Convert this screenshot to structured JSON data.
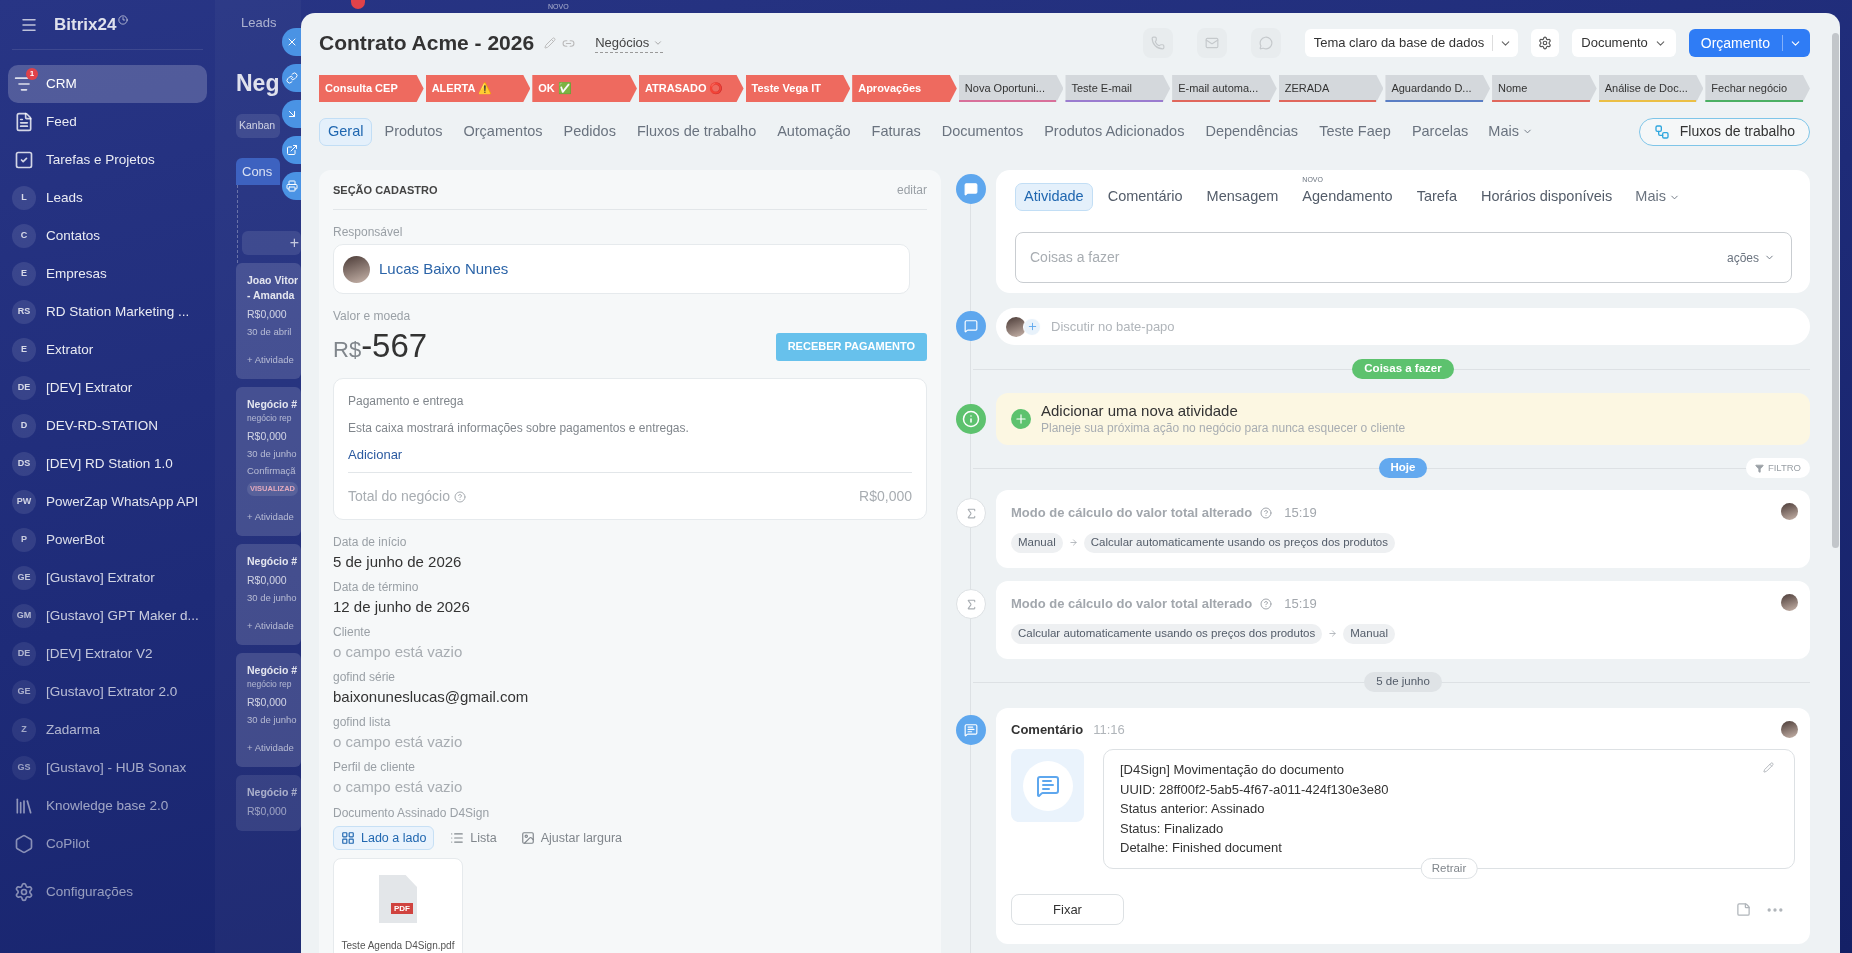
{
  "sidebar": {
    "logo": "Bitrix24",
    "items": [
      {
        "kind": "funnel",
        "label": "CRM",
        "selected": true,
        "counter": "1"
      },
      {
        "kind": "feed",
        "label": "Feed",
        "selected": false
      },
      {
        "kind": "tasks",
        "label": "Tarefas e Projetos",
        "selected": false
      },
      {
        "kind": "initials",
        "initials": "L",
        "label": "Leads",
        "selected": false
      },
      {
        "kind": "initials",
        "initials": "C",
        "label": "Contatos",
        "selected": false
      },
      {
        "kind": "initials",
        "initials": "E",
        "label": "Empresas",
        "selected": false
      },
      {
        "kind": "initials",
        "initials": "RS",
        "label": "RD Station Marketing ...",
        "selected": false
      },
      {
        "kind": "initials",
        "initials": "E",
        "label": "Extrator",
        "selected": false
      },
      {
        "kind": "initials",
        "initials": "DE",
        "label": "[DEV] Extrator",
        "selected": false
      },
      {
        "kind": "initials",
        "initials": "D",
        "label": "DEV-RD-STATION",
        "selected": false
      },
      {
        "kind": "initials",
        "initials": "DS",
        "label": "[DEV] RD Station 1.0",
        "selected": false
      },
      {
        "kind": "initials",
        "initials": "PW",
        "label": "PowerZap WhatsApp API",
        "selected": false
      },
      {
        "kind": "initials",
        "initials": "P",
        "label": "PowerBot",
        "selected": false
      },
      {
        "kind": "initials",
        "initials": "GE",
        "label": "[Gustavo] Extrator",
        "selected": false
      },
      {
        "kind": "initials",
        "initials": "GM",
        "label": "[Gustavo] GPT Maker d...",
        "selected": false
      },
      {
        "kind": "initials",
        "initials": "DE",
        "label": "[DEV] Extrator V2",
        "selected": false
      },
      {
        "kind": "initials",
        "initials": "GE",
        "label": "[Gustavo] Extrator 2.0",
        "selected": false
      },
      {
        "kind": "initials",
        "initials": "Z",
        "label": "Zadarma",
        "selected": false
      },
      {
        "kind": "initials",
        "initials": "GS",
        "label": "[Gustavo] - HUB Sonax",
        "selected": false
      },
      {
        "kind": "book",
        "label": "Knowledge base 2.0",
        "selected": false
      },
      {
        "kind": "copilot",
        "label": "CoPilot",
        "selected": false
      },
      {
        "kind": "settings",
        "label": "Configurações",
        "selected": false
      }
    ]
  },
  "backdrop": {
    "tab": "Leads",
    "new_label": "NOVO",
    "heading": "Neg",
    "view_button": "Kanban",
    "column": "Cons",
    "add_label": "+",
    "cards": [
      {
        "lines": [
          {
            "kind": "title",
            "text": "Joao Vitor"
          },
          {
            "kind": "title",
            "text": "- Amanda"
          },
          {
            "kind": "price",
            "text": "R$0,000"
          },
          {
            "kind": "date",
            "text": "30 de abril"
          },
          {
            "kind": "action",
            "text": "+ Atividade"
          }
        ]
      },
      {
        "lines": [
          {
            "kind": "title",
            "text": "Negócio #"
          },
          {
            "kind": "note",
            "text": "negócio rep"
          },
          {
            "kind": "price",
            "text": "R$0,000"
          },
          {
            "kind": "date",
            "text": "30 de junho"
          },
          {
            "kind": "date",
            "text": "Confirmaçã"
          },
          {
            "kind": "tag",
            "text": "VISUALIZAD"
          },
          {
            "kind": "action",
            "text": "+ Atividade"
          }
        ]
      },
      {
        "lines": [
          {
            "kind": "title",
            "text": "Negócio #"
          },
          {
            "kind": "price",
            "text": "R$0,000"
          },
          {
            "kind": "date",
            "text": "30 de junho"
          },
          {
            "kind": "action",
            "text": "+ Atividade"
          }
        ]
      },
      {
        "lines": [
          {
            "kind": "title",
            "text": "Negócio #"
          },
          {
            "kind": "note",
            "text": "negócio rep"
          },
          {
            "kind": "price",
            "text": "R$0,000"
          },
          {
            "kind": "date",
            "text": "30 de junho"
          },
          {
            "kind": "action",
            "text": "+ Atividade"
          }
        ]
      },
      {
        "lines": [
          {
            "kind": "title",
            "text": "Negócio #"
          },
          {
            "kind": "price",
            "text": "R$0,000"
          }
        ]
      }
    ]
  },
  "deal": {
    "title": "Contrato Acme - 2026",
    "category": "Negócios",
    "communication": [
      {
        "kind": "phone",
        "disabled": true
      },
      {
        "kind": "mail",
        "disabled": true
      },
      {
        "kind": "chat",
        "disabled": true
      }
    ],
    "theme_select": "Tema claro da base de dados",
    "document_button": "Documento",
    "primary_button": "Orçamento",
    "stages": [
      {
        "label": "Consulta CEP",
        "passed": true,
        "color": "#ee6a5f"
      },
      {
        "label": "ALERTA ⚠️",
        "passed": true,
        "color": "#ee6a5f"
      },
      {
        "label": "OK ✅",
        "passed": true,
        "color": "#ee6a5f"
      },
      {
        "label": "ATRASADO ⭕",
        "passed": true,
        "color": "#ee6a5f"
      },
      {
        "label": "Teste Vega IT",
        "passed": true,
        "color": "#ee6a5f"
      },
      {
        "label": "Aprovações",
        "passed": true,
        "color": "#ee6a5f"
      },
      {
        "label": "Nova Oportuni...",
        "passed": false,
        "color": "#d8709a"
      },
      {
        "label": "Teste E-mail",
        "passed": false,
        "color": "#9a7ccf"
      },
      {
        "label": "E-mail automa...",
        "passed": false,
        "color": "#e0675c"
      },
      {
        "label": "ZERADA",
        "passed": false,
        "color": "#e0675c"
      },
      {
        "label": "Aguardando D...",
        "passed": false,
        "color": "#5a7ec4"
      },
      {
        "label": "Nome",
        "passed": false,
        "color": "#e0675c"
      },
      {
        "label": "Análise de Doc...",
        "passed": false,
        "color": "#ebbf45"
      },
      {
        "label": "Fechar negócio",
        "passed": false,
        "color": "#4caf63"
      }
    ],
    "tabs": [
      {
        "label": "Geral",
        "selected": true
      },
      {
        "label": "Produtos",
        "selected": false
      },
      {
        "label": "Orçamentos",
        "selected": false
      },
      {
        "label": "Pedidos",
        "selected": false
      },
      {
        "label": "Fluxos de trabalho",
        "selected": false
      },
      {
        "label": "Automação",
        "selected": false
      },
      {
        "label": "Faturas",
        "selected": false
      },
      {
        "label": "Documentos",
        "selected": false
      },
      {
        "label": "Produtos Adicionados",
        "selected": false
      },
      {
        "label": "Dependências",
        "selected": false
      },
      {
        "label": "Teste Faep",
        "selected": false
      },
      {
        "label": "Parcelas",
        "selected": false
      }
    ],
    "more_tab": "Mais",
    "workflow_button": "Fluxos de trabalho",
    "details": {
      "section_title": "SEÇÃO CADASTRO",
      "edit": "editar",
      "responsible_label": "Responsável",
      "responsible": "Lucas Baixo Nunes",
      "amount_label": "Valor e moeda",
      "currency": "R$",
      "amount": "-567",
      "payment_button": "RECEBER PAGAMENTO",
      "payment": {
        "title": "Pagamento e entrega",
        "text": "Esta caixa mostrará informações sobre pagamentos e entregas.",
        "link": "Adicionar",
        "total_label": "Total do negócio",
        "total": "R$0,000"
      },
      "fields": [
        {
          "label": "Data de início",
          "value": "5 de junho de 2026",
          "empty": false
        },
        {
          "label": "Data de término",
          "value": "12 de junho de 2026",
          "empty": false
        },
        {
          "label": "Cliente",
          "value": "o campo está vazio",
          "empty": true
        },
        {
          "label": "gofind série",
          "value": "baixonuneslucas@gmail.com",
          "empty": false
        },
        {
          "label": "gofind lista",
          "value": "o campo está vazio",
          "empty": true
        },
        {
          "label": "Perfil de cliente",
          "value": "o campo está vazio",
          "empty": true
        }
      ],
      "documents_label": "Documento Assinado D4Sign",
      "views": [
        {
          "kind": "grid",
          "label": "Lado a lado",
          "selected": true
        },
        {
          "kind": "list",
          "label": "Lista",
          "selected": false
        },
        {
          "kind": "image",
          "label": "Ajustar largura",
          "selected": false
        }
      ],
      "files": [
        {
          "type": "PDF",
          "name": "Teste Agenda D4Sign.pdf"
        }
      ]
    },
    "timeline": {
      "composer": {
        "tabs": [
          {
            "label": "Atividade",
            "selected": true
          },
          {
            "label": "Comentário",
            "selected": false
          },
          {
            "label": "Mensagem",
            "selected": false
          },
          {
            "label": "Agendamento",
            "selected": false,
            "badge": "NOVO"
          },
          {
            "label": "Tarefa",
            "selected": false
          },
          {
            "label": "Horários disponíveis",
            "selected": false
          }
        ],
        "more": "Mais",
        "placeholder": "Coisas a fazer",
        "actions": "ações"
      },
      "chat_placeholder": "Discutir no bate-papo",
      "pending_label": "Coisas a fazer",
      "suggestion": {
        "title": "Adicionar uma nova atividade",
        "text": "Planeje sua próxima ação no negócio para nunca esquecer o cliente"
      },
      "today_label": "Hoje",
      "filter": "FILTRO",
      "events": [
        {
          "title": "Modo de cálculo do valor total alterado",
          "time": "15:19",
          "from": "Manual",
          "to": "Calcular automaticamente usando os preços dos produtos"
        },
        {
          "title": "Modo de cálculo do valor total alterado",
          "time": "15:19",
          "from": "Calcular automaticamente usando os preços dos produtos",
          "to": "Manual"
        }
      ],
      "date_label": "5 de junho",
      "comment": {
        "title": "Comentário",
        "time": "11:16",
        "lines": [
          "[D4Sign] Movimentação do documento",
          "UUID: 28ff00f2-5ab5-4f67-a011-424f130e3e80",
          "Status anterior: Assinado",
          "Status: Finalizado",
          "Detalhe: Finished document"
        ],
        "collapse": "Retrair",
        "pin": "Fixar"
      }
    }
  }
}
